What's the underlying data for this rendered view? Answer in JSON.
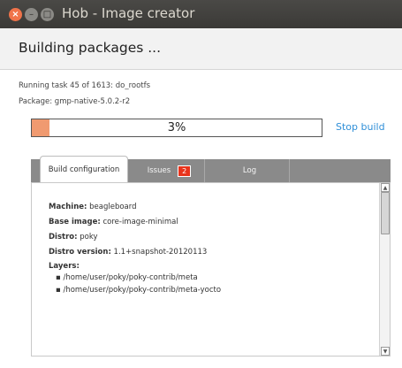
{
  "window": {
    "title": "Hob - Image creator",
    "close_glyph": "×",
    "min_glyph": "–",
    "max_glyph": "□"
  },
  "header": {
    "heading": "Building packages ..."
  },
  "status": {
    "task_text": "Running task 45 of 1613:  do_rootfs",
    "package_text": "Package: gmp-native-5.0.2-r2"
  },
  "progress": {
    "percent_label": "3%",
    "fraction": 0.06
  },
  "stop_button": "Stop build",
  "tabs": {
    "build_config": "Build configuration",
    "issues": "Issues",
    "issues_count": "2",
    "log": "Log"
  },
  "config": {
    "machine_label": "Machine:",
    "machine_value": "beagleboard",
    "base_image_label": "Base image:",
    "base_image_value": "core-image-minimal",
    "distro_label": "Distro:",
    "distro_value": "poky",
    "distro_version_label": "Distro version:",
    "distro_version_value": "1.1+snapshot-20120113",
    "layers_label": "Layers:",
    "layers": [
      "/home/user/poky/poky-contrib/meta",
      "/home/user/poky/poky-contrib/meta-yocto"
    ]
  },
  "colors": {
    "accent": "#2f8fd8",
    "progress_fill": "#f09a70",
    "badge": "#e8341c",
    "close": "#f0734a"
  }
}
